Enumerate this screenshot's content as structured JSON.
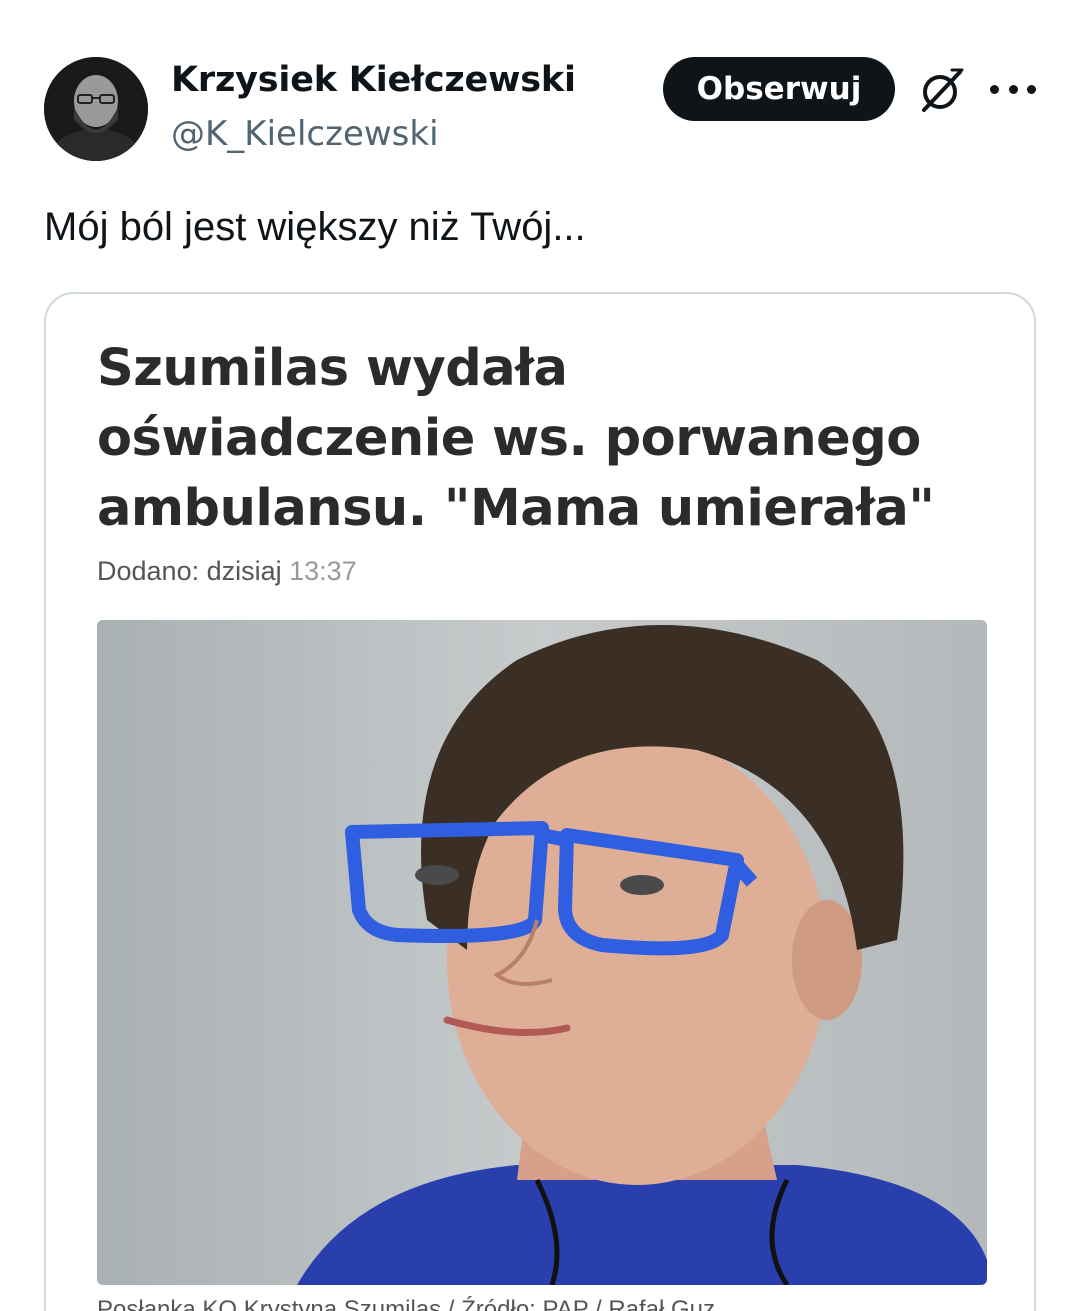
{
  "tweet": {
    "author_name": "Krzysiek Kiełczewski",
    "author_handle": "@K_Kielczewski",
    "follow_label": "Obserwuj",
    "text": "Mój ból jest większy niż Twój...",
    "icons": {
      "avatar": "avatar",
      "grok": "grok-icon",
      "more": "more-options-icon"
    }
  },
  "article": {
    "headline": "Szumilas wydała\noświadczenie ws. porwanego\nambulansu. \"Mama umierała\"",
    "added_label": "Dodano: dzisiaj",
    "time": "13:37",
    "caption": "Posłanka KO Krystyna Szumilas / Źródło: PAP / Rafał Guz"
  },
  "colors": {
    "follow_button_bg": "#0f1419",
    "handle_text": "#536471",
    "card_border": "#cfd9de",
    "glasses": "#2f5fe0"
  }
}
